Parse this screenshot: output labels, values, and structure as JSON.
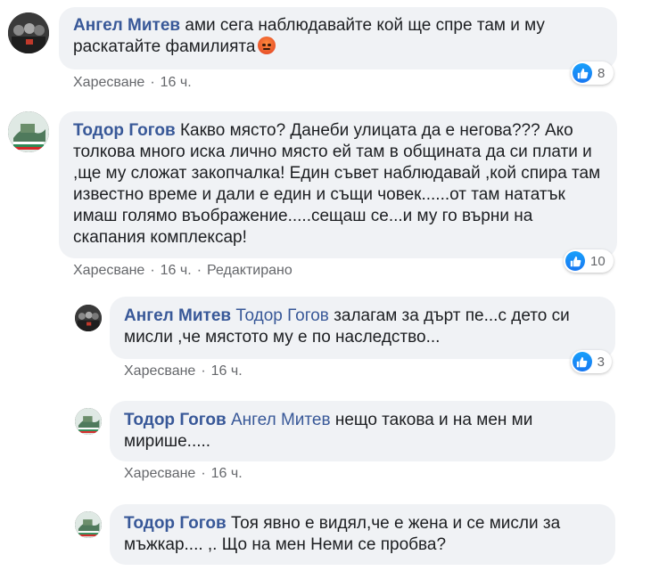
{
  "comments": [
    {
      "author": "Ангел Митев",
      "text": "ами сега наблюдавайте кой ще спре там и му раскатайте фамилията",
      "emoji": "angry-face-emoji",
      "like_label": "Харесване",
      "time": "16 ч.",
      "reaction_count": "8"
    },
    {
      "author": "Тодор Гогов",
      "text": "Какво място? Данеби улицата да е негова??? Ако толкова много иска лично място ей там в общината да си плати и ,ще му сложат закопчалка! Един съвет наблюдавай ,кой спира там известно време и дали е един и същи човек......от там нататък имаш голямо въображение.....сещаш се...и му го върни на скапания комплексар!",
      "like_label": "Харесване",
      "time": "16 ч.",
      "edited": "Редактирано",
      "reaction_count": "10"
    }
  ],
  "replies": [
    {
      "author": "Ангел Митев",
      "mention": "Тодор Гогов",
      "text": "залагам за дърт пе...с дето си мисли ,че мястото му е по наследство...",
      "like_label": "Харесване",
      "time": "16 ч.",
      "reaction_count": "3"
    },
    {
      "author": "Тодор Гогов",
      "mention": "Ангел Митев",
      "text": "нещо такова и на мен ми мирише.....",
      "like_label": "Харесване",
      "time": "16 ч."
    },
    {
      "author": "Тодор Гогов",
      "text": "Тоя явно е видял,че е жена и се мисли за мъжкар.... ,. Що на мен Неми се пробва?"
    }
  ],
  "separator": "·",
  "colors": {
    "author_link": "#385898",
    "bubble_bg": "#f0f2f5",
    "meta_text": "#65676b",
    "like_blue": "#1877f2"
  }
}
